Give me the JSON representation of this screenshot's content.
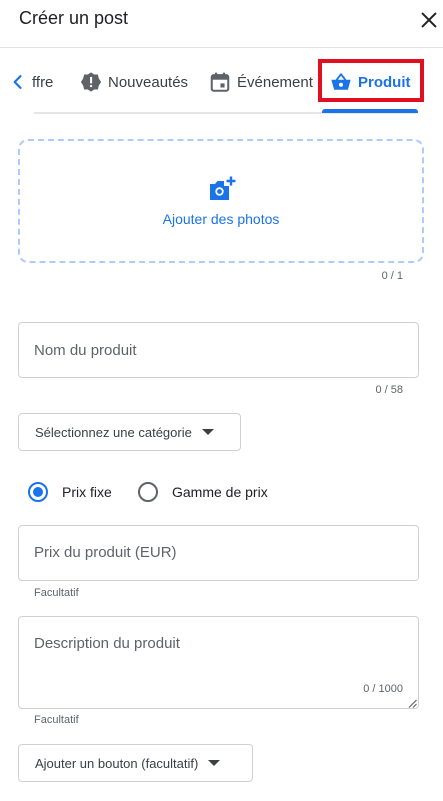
{
  "header": {
    "title": "Créer un post"
  },
  "tabs": [
    {
      "label": "ffre",
      "icon": "offer-tag-icon"
    },
    {
      "label": "Nouveautés",
      "icon": "gear-icon"
    },
    {
      "label": "Événement",
      "icon": "calendar-icon"
    },
    {
      "label": "Produit",
      "icon": "shopping-basket-icon",
      "active": true
    }
  ],
  "photos": {
    "label": "Ajouter des photos",
    "counter": "0 / 1"
  },
  "product_name": {
    "placeholder": "Nom du produit",
    "counter": "0 / 58"
  },
  "category": {
    "label": "Sélectionnez une catégorie"
  },
  "price_type": {
    "options": [
      "Prix fixe",
      "Gamme de prix"
    ],
    "selected": "Prix fixe"
  },
  "price": {
    "placeholder": "Prix du produit (EUR)",
    "helper": "Facultatif"
  },
  "description": {
    "placeholder": "Description du produit",
    "counter": "0 / 1000",
    "helper": "Facultatif"
  },
  "button_select": {
    "label": "Ajouter un bouton (facultatif)"
  },
  "colors": {
    "accent": "#1a73e8",
    "highlight": "#e01020"
  }
}
